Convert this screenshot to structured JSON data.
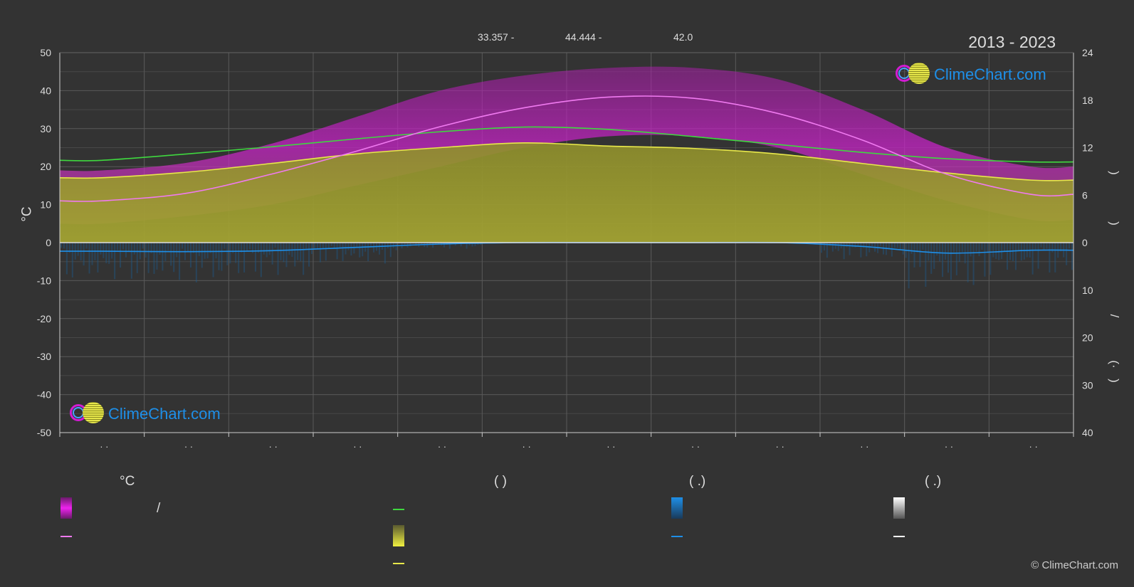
{
  "header": {
    "stat1": "33.357 -",
    "stat2": "44.444 -",
    "stat3": "42.0",
    "years": "2013 - 2023"
  },
  "logo_text": "ClimeChart.com",
  "copyright": "© ClimeChart.com",
  "chart_data": {
    "type": "area",
    "left_axis": {
      "label": "°C",
      "min": -50,
      "max": 50,
      "ticks": [
        50,
        40,
        30,
        20,
        10,
        0,
        -10,
        -20,
        -30,
        -40,
        -50
      ]
    },
    "right_axis_top": {
      "min": 0,
      "max": 24,
      "ticks": [
        24,
        18,
        12,
        6,
        0
      ]
    },
    "right_axis_bottom": {
      "min": 0,
      "max": 40,
      "ticks": [
        0,
        10,
        20,
        30,
        40
      ]
    },
    "right_axis_symbols": [
      ")",
      ")",
      "/",
      "(·",
      ")"
    ],
    "x_tick_labels": [
      "· ·",
      "· ·",
      "· ·",
      "· ·",
      "· ·",
      "· ·",
      "· ·",
      "· ·",
      "· ·",
      "· ·",
      "· ·",
      "· ·"
    ],
    "grid": true,
    "months": 12,
    "series": [
      {
        "name": "daylight-hours",
        "color": "#3fd83f",
        "axis": "right-top",
        "values": [
          10.4,
          11.2,
          12.1,
          13.1,
          14.0,
          14.6,
          14.3,
          13.4,
          12.4,
          11.4,
          10.6,
          10.2
        ]
      },
      {
        "name": "sunshine-hours",
        "color": "#e8e84a",
        "axis": "right-top",
        "values": [
          8.2,
          8.9,
          10.0,
          11.2,
          12.0,
          12.6,
          12.2,
          11.9,
          11.2,
          10.0,
          8.8,
          7.9
        ]
      },
      {
        "name": "avg-temperature",
        "color": "#f07af0",
        "axis": "left",
        "values": [
          11,
          13,
          18,
          24,
          30.5,
          35.5,
          38.3,
          38.0,
          34.0,
          27.0,
          18.0,
          12.7
        ]
      },
      {
        "name": "daily-max-temperature-top",
        "color": "#cc22cc",
        "axis": "left",
        "values": [
          19,
          21,
          26,
          33,
          40,
          44,
          46,
          46,
          43,
          35,
          25,
          20
        ]
      },
      {
        "name": "daily-max-temperature-bottom",
        "color": "#cc22cc",
        "axis": "left",
        "values": [
          5,
          7,
          10,
          15,
          20,
          25,
          28,
          28,
          25,
          18,
          11,
          6
        ]
      },
      {
        "name": "precipitation",
        "color": "#1e8fe8",
        "axis": "right-bottom",
        "values": [
          1.8,
          1.9,
          1.7,
          1.0,
          0.3,
          0.0,
          0.0,
          0.0,
          0.0,
          0.8,
          2.2,
          1.6
        ]
      }
    ]
  },
  "legend": {
    "col1": {
      "head": "°C",
      "slash": "/"
    },
    "col2": {
      "head": "(          )"
    },
    "col3": {
      "head": "(   .)"
    },
    "col4": {
      "head": "(   .)"
    }
  },
  "colors": {
    "background": "#333333",
    "magenta": "#d21cd2",
    "pink": "#f07af0",
    "green": "#3fd83f",
    "yellow": "#e8e84a",
    "blue": "#1e8fe8",
    "white": "#ffffff",
    "olive": "#9a9a30"
  }
}
